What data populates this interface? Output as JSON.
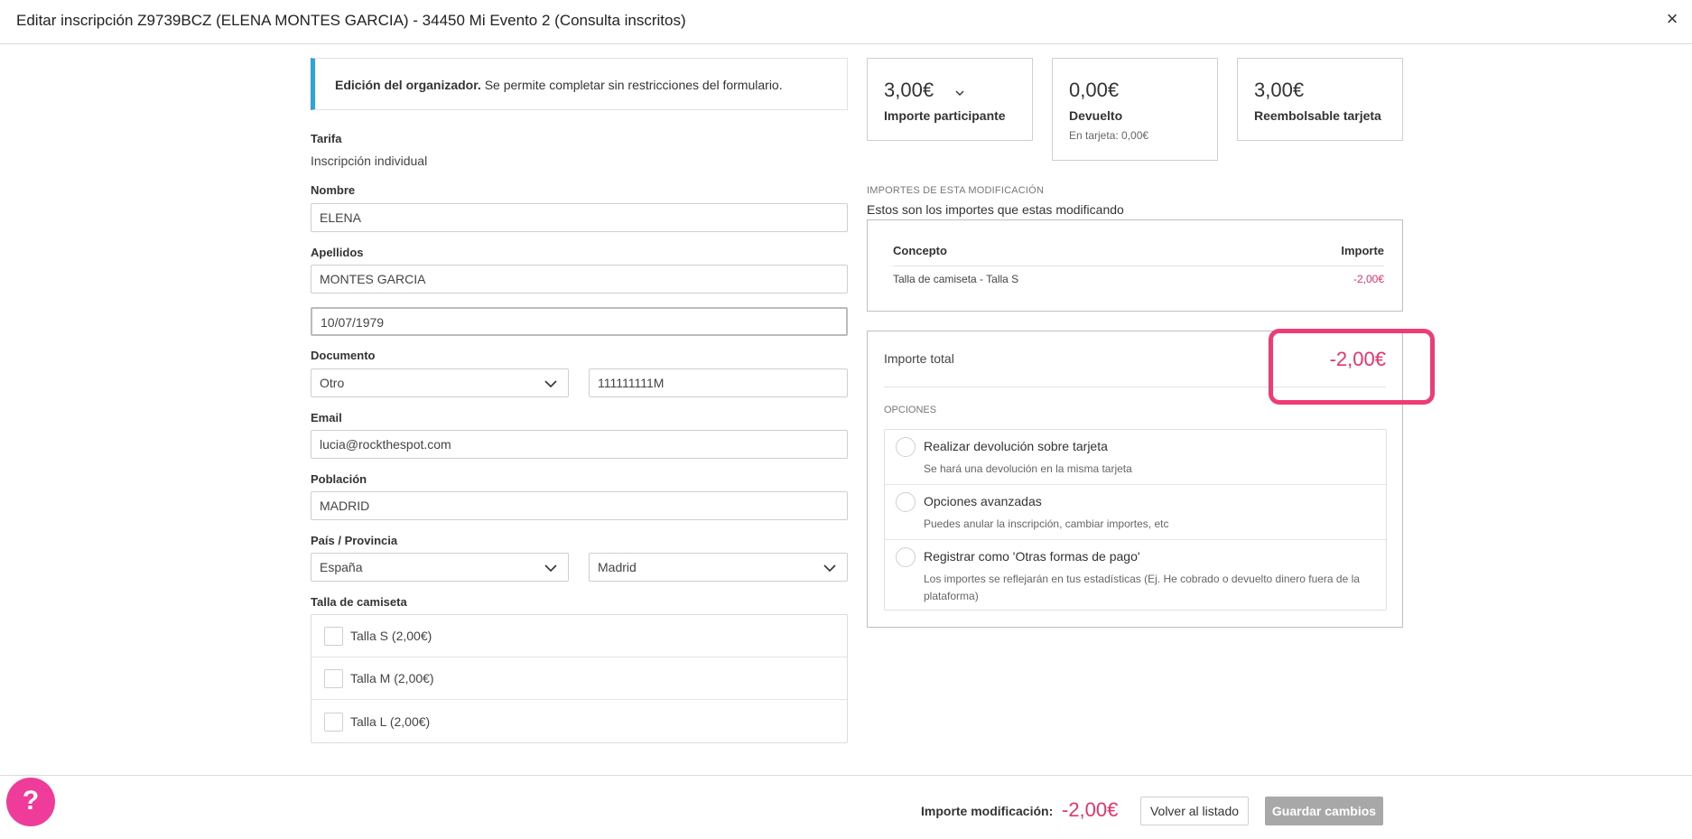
{
  "header": {
    "title": "Editar inscripción Z9739BCZ (ELENA MONTES GARCIA) - 34450 Mi Evento 2 (Consulta inscritos)",
    "close": "×"
  },
  "info": {
    "bold": "Edición del organizador.",
    "text": " Se permite completar sin restricciones del formulario."
  },
  "form": {
    "tarifa_label": "Tarifa",
    "tarifa_value": "Inscripción individual",
    "nombre_label": "Nombre",
    "nombre_value": "ELENA",
    "apellidos_label": "Apellidos",
    "apellidos_value": "MONTES GARCIA",
    "fecha_value": "10/07/1979",
    "documento_label": "Documento",
    "documento_tipo": "Otro",
    "documento_numero": "111111111M",
    "email_label": "Email",
    "email_value": "lucia@rockthespot.com",
    "poblacion_label": "Población",
    "poblacion_value": "MADRID",
    "pais_label": "País / Provincia",
    "pais_value": "España",
    "provincia_value": "Madrid",
    "talla_label": "Talla de camiseta",
    "tallas": [
      "Talla S (2,00€)",
      "Talla M (2,00€)",
      "Talla L (2,00€)"
    ]
  },
  "stats": [
    {
      "amount": "3,00€",
      "label": "Importe participante",
      "sub": ""
    },
    {
      "amount": "0,00€",
      "label": "Devuelto",
      "sub": "En tarjeta: 0,00€"
    },
    {
      "amount": "3,00€",
      "label": "Reembolsable tarjeta",
      "sub": ""
    }
  ],
  "modificacion": {
    "caption": "IMPORTES DE ESTA MODIFICACIÓN",
    "desc": "Estos son los importes que estas modificando",
    "col_concepto": "Concepto",
    "col_importe": "Importe",
    "row_concepto": "Talla de camiseta - Talla S",
    "row_importe": "-2,00€"
  },
  "total": {
    "label": "Importe total",
    "amount": "-2,00€",
    "opciones_caption": "OPCIONES",
    "options": [
      {
        "title": "Realizar devolución sobre tarjeta",
        "desc": "Se hará una devolución en la misma tarjeta"
      },
      {
        "title": "Opciones avanzadas",
        "desc": "Puedes anular la inscripción, cambiar importes, etc"
      },
      {
        "title": "Registrar como 'Otras formas de pago'",
        "desc": "Los importes se reflejarán en tus estadísticas (Ej. He cobrado o devuelto dinero fuera de la plataforma)"
      }
    ]
  },
  "footer": {
    "label": "Importe modificación:",
    "amount": "-2,00€",
    "back_button": "Volver al listado",
    "save_button": "Guardar cambios",
    "help": "?"
  },
  "colors": {
    "accent_pink": "#e8336b",
    "info_border": "#2aa6d8",
    "help_button": "#ef3c9a",
    "save_disabled": "#a8a8a8"
  }
}
